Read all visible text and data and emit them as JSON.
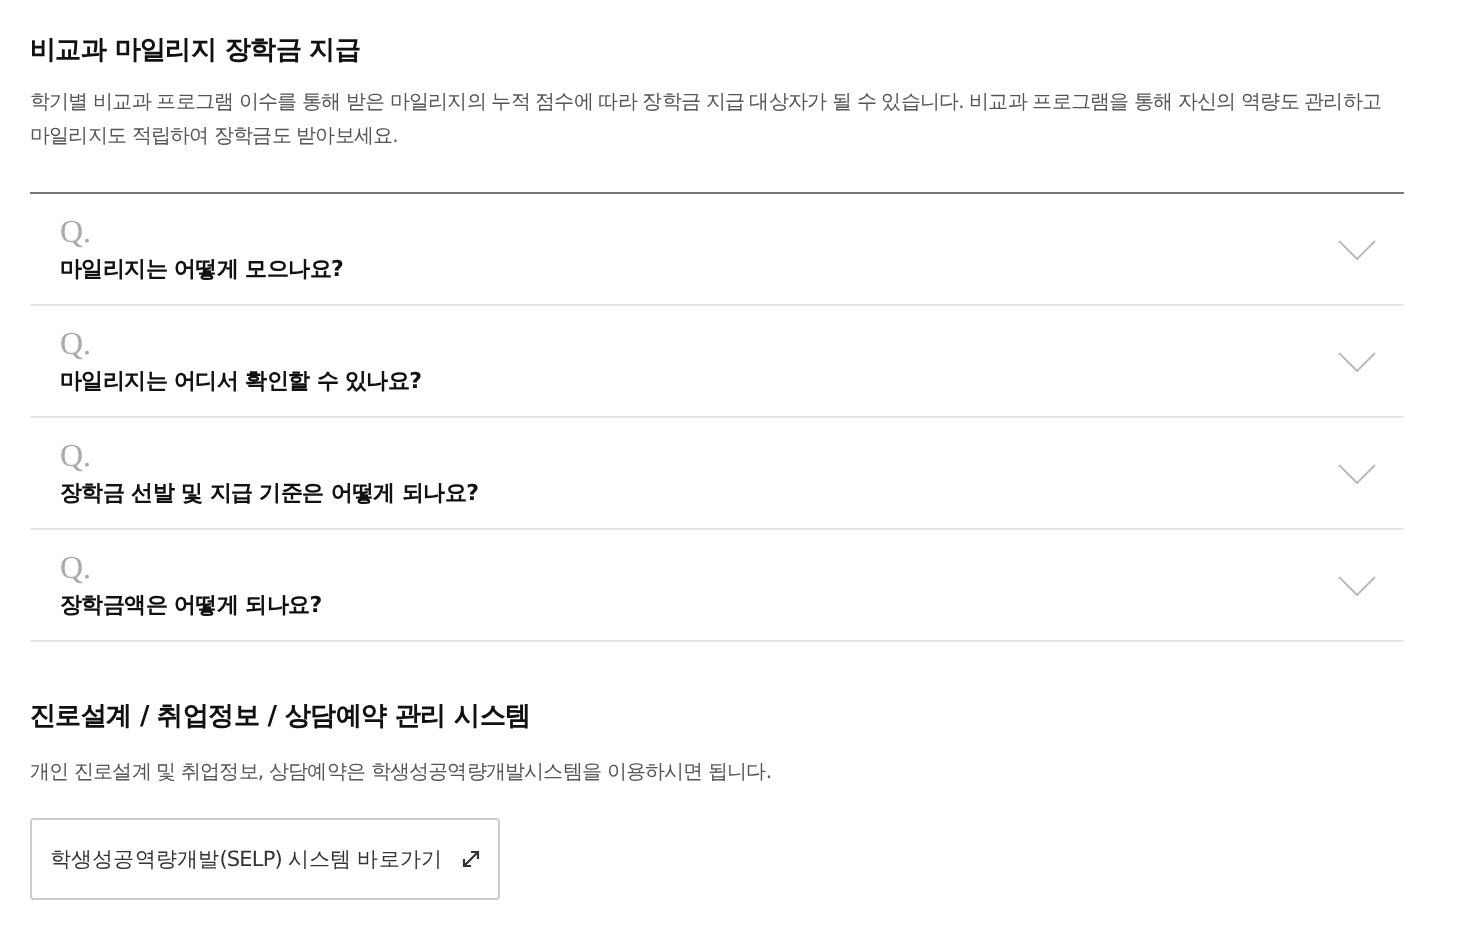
{
  "scholarship": {
    "title": "비교과 마일리지 장학금 지급",
    "description": "학기별 비교과 프로그램 이수를 통해 받은 마일리지의 누적 점수에 따라 장학금 지급 대상자가 될 수 있습니다. 비교과 프로그램을 통해 자신의 역량도 관리하고 마일리지도 적립하여 장학금도 받아보세요."
  },
  "faq": [
    {
      "marker": "Q.",
      "question": "마일리지는 어떻게 모으나요?",
      "expanded": false
    },
    {
      "marker": "Q.",
      "question": "마일리지는 어디서 확인할 수 있나요?",
      "expanded": false
    },
    {
      "marker": "Q.",
      "question": "장학금 선발 및 지급 기준은 어떻게 되나요?",
      "expanded": false
    },
    {
      "marker": "Q.",
      "question": "장학금액은 어떻게 되나요?",
      "expanded": false
    }
  ],
  "career": {
    "title": "진로설계 / 취업정보 / 상담예약 관리 시스템",
    "description": "개인 진로설계 및 취업정보, 상담예약은 학생성공역량개발시스템을 이용하시면 됩니다.",
    "link_button": "학생성공역량개발(SELP) 시스템 바로가기"
  }
}
